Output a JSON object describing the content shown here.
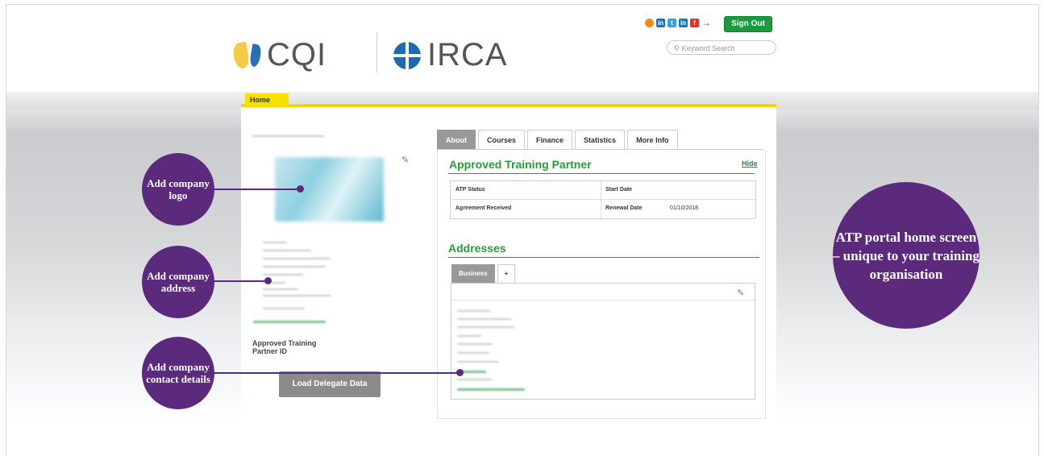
{
  "header": {
    "logo_cqi": "CQI",
    "logo_irca": "IRCA",
    "signout_label": "Sign Out",
    "search_placeholder": "Keyword Search",
    "social_icons": [
      "rss-icon",
      "linkedin-icon",
      "twitter-icon",
      "linkedin-icon",
      "facebook-icon",
      "arrow-icon"
    ]
  },
  "nav": {
    "home_tab": "Home"
  },
  "sidebar": {
    "atp_id_label": "Approved Training Partner ID",
    "load_button": "Load Delegate Data"
  },
  "tabs": [
    "About",
    "Courses",
    "Finance",
    "Statistics",
    "More Info"
  ],
  "atp_section": {
    "title": "Approved Training Partner",
    "hide_link": "Hide",
    "fields": {
      "atp_status": "ATP Status",
      "start_date": "Start Date",
      "agreement_received": "Agreement Received",
      "renewal_date": "Renewal Date",
      "renewal_value": "01/10/2018"
    }
  },
  "addresses": {
    "title": "Addresses",
    "tabs": [
      "Business",
      "+"
    ]
  },
  "callouts": {
    "logo": "Add company logo",
    "address": "Add company address",
    "contact": "Add company contact details",
    "main": "ATP portal home screen – unique to your training organisation"
  },
  "colors": {
    "accent_yellow": "#f3d600",
    "green": "#2a9a3a",
    "purple": "#5b2a7d"
  }
}
